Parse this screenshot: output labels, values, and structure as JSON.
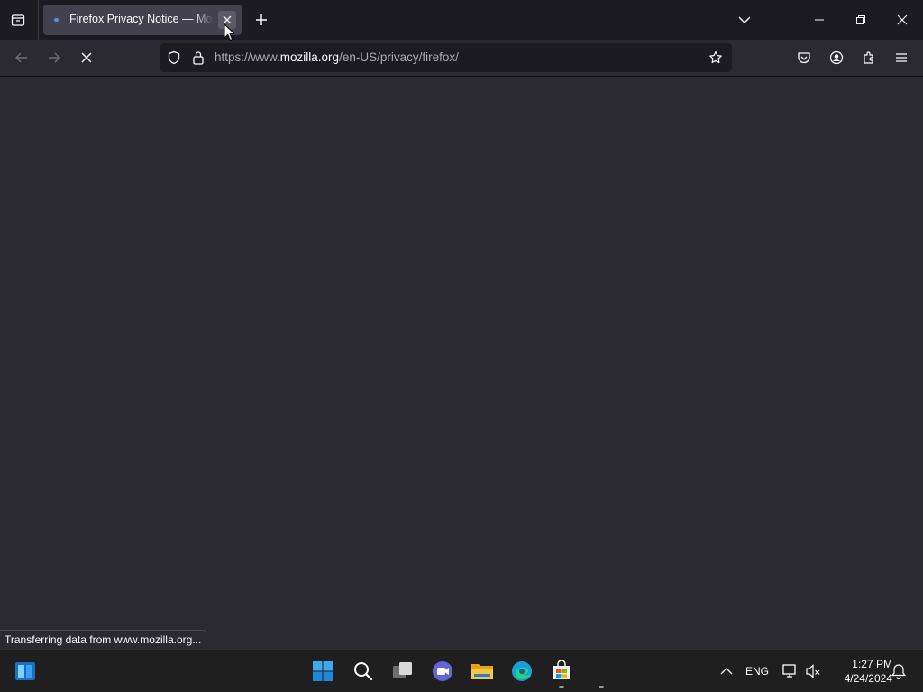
{
  "browser": {
    "tab": {
      "title": "Firefox Privacy Notice — Mozilla"
    },
    "url": {
      "prefix": "https://www.",
      "host": "mozilla.org",
      "path": "/en-US/privacy/firefox/"
    },
    "status_text": "Transferring data from www.mozilla.org..."
  },
  "taskbar": {
    "language": "ENG",
    "time": "1:27 PM",
    "date": "4/24/2024"
  },
  "colors": {
    "chrome_dark": "#1c1b22",
    "toolbar": "#2b2a33",
    "tab_selected": "#42414d",
    "text": "#fbfbfe",
    "taskbar": "#1f1f1f"
  },
  "icons": [
    "tab-list-icon",
    "close-icon",
    "plus-icon",
    "chevron-down-icon",
    "minimize-icon",
    "restore-icon",
    "back-icon",
    "forward-icon",
    "stop-icon",
    "shield-icon",
    "lock-icon",
    "star-icon",
    "pocket-icon",
    "account-icon",
    "extensions-icon",
    "menu-icon",
    "widgets-icon",
    "windows-start-icon",
    "search-icon",
    "task-view-icon",
    "teams-icon",
    "file-explorer-icon",
    "edge-icon",
    "store-icon",
    "chevron-up-icon",
    "network-icon",
    "volume-muted-icon",
    "notification-icon"
  ]
}
